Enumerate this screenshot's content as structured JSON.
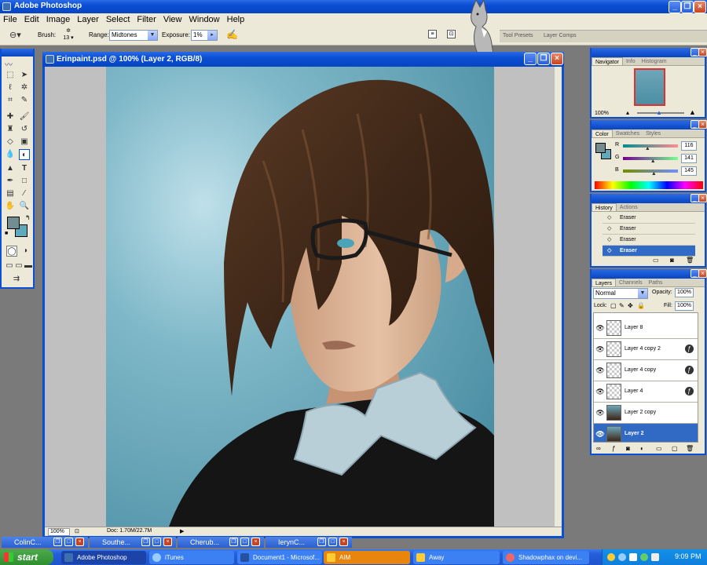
{
  "app": {
    "title": "Adobe Photoshop"
  },
  "menu": [
    "File",
    "Edit",
    "Image",
    "Layer",
    "Select",
    "Filter",
    "View",
    "Window",
    "Help"
  ],
  "options": {
    "brush_label": "Brush:",
    "brush_size": "13",
    "range_label": "Range:",
    "range_value": "Midtones",
    "exposure_label": "Exposure:",
    "exposure_value": "1%",
    "well_tabs": [
      "Tool Presets",
      "Layer Comps"
    ]
  },
  "document": {
    "title": "Erinpaint.psd @ 100% (Layer 2, RGB/8)",
    "zoom": "100%",
    "doc_size": "Doc: 1.70M/22.7M"
  },
  "navigator": {
    "tabs": [
      "Navigator",
      "Info",
      "Histogram"
    ],
    "zoom": "100%"
  },
  "color": {
    "tabs": [
      "Color",
      "Swatches",
      "Styles"
    ],
    "r_label": "R",
    "g_label": "G",
    "b_label": "B",
    "r": "116",
    "g": "141",
    "b": "145",
    "r_frac": 0.455,
    "g_frac": 0.553,
    "b_frac": 0.569,
    "fg": "#748d91",
    "bg": "#5fa9bd"
  },
  "history": {
    "tabs": [
      "History",
      "Actions"
    ],
    "items": [
      "Eraser",
      "Eraser",
      "Eraser",
      "Eraser"
    ]
  },
  "layers": {
    "tabs": [
      "Layers",
      "Channels",
      "Paths"
    ],
    "blend": "Normal",
    "opacity_label": "Opacity:",
    "opacity": "100%",
    "fill_label": "Fill:",
    "fill": "100%",
    "lock_label": "Lock:",
    "items": [
      {
        "name": "Layer 8",
        "fx": false,
        "selected": false
      },
      {
        "name": "Layer 4 copy 2",
        "fx": true,
        "selected": false
      },
      {
        "name": "Layer 4 copy",
        "fx": true,
        "selected": false
      },
      {
        "name": "Layer 4",
        "fx": true,
        "selected": false
      },
      {
        "name": "Layer 2 copy",
        "fx": false,
        "selected": false
      },
      {
        "name": "Layer 2",
        "fx": false,
        "selected": true
      }
    ]
  },
  "minimized": [
    "ColinC...",
    "Southe...",
    "Cherub...",
    "IerynC..."
  ],
  "taskbar": {
    "start": "start",
    "items": [
      "Adobe Photoshop",
      "iTunes",
      "Document1 - Microsof...",
      "AIM",
      "Away",
      "Shadowphax on devi..."
    ],
    "clock": "9:09 PM"
  }
}
